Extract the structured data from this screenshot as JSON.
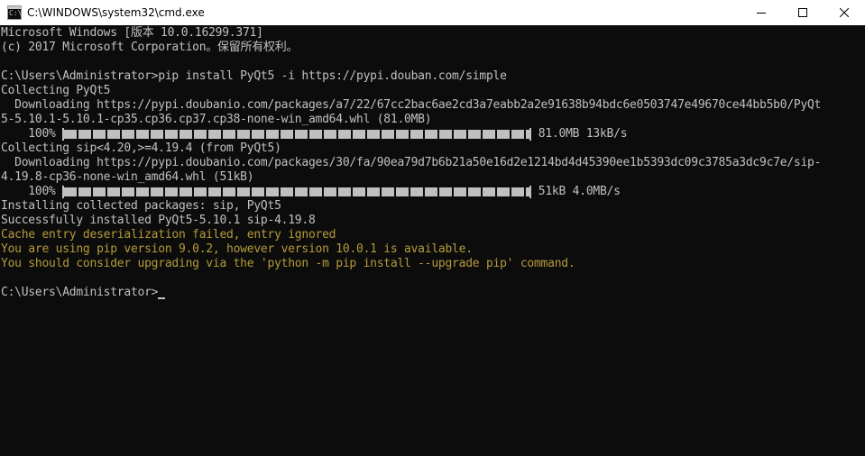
{
  "window": {
    "title": "C:\\WINDOWS\\system32\\cmd.exe",
    "icon": "cmd-icon",
    "controls": [
      "minimize-icon",
      "maximize-icon",
      "close-icon"
    ]
  },
  "console": {
    "text_color": "#c0c0c0",
    "warning_color": "#b59a3a",
    "background": "#0c0c0c",
    "lines": {
      "l1": "Microsoft Windows [版本 10.0.16299.371]",
      "l2": "(c) 2017 Microsoft Corporation。保留所有权利。",
      "l3": "",
      "l4": "C:\\Users\\Administrator>pip install PyQt5 -i https://pypi.douban.com/simple",
      "l5": "Collecting PyQt5",
      "l6": "  Downloading https://pypi.doubanio.com/packages/a7/22/67cc2bac6ae2cd3a7eabb2a2e91638b94bdc6e0503747e49670ce44bb5b0/PyQt",
      "l7": "5-5.10.1-5.10.1-cp35.cp36.cp37.cp38-none-win_amd64.whl (81.0MB)",
      "l9": "Collecting sip<4.20,>=4.19.4 (from PyQt5)",
      "l10": "  Downloading https://pypi.doubanio.com/packages/30/fa/90ea79d7b6b21a50e16d2e1214bd4d45390ee1b5393dc09c3785a3dc9c7e/sip-",
      "l11": "4.19.8-cp36-none-win_amd64.whl (51kB)",
      "l13": "Installing collected packages: sip, PyQt5",
      "l14": "Successfully installed PyQt5-5.10.1 sip-4.19.8",
      "l15": "Cache entry deserialization failed, entry ignored",
      "l16": "You are using pip version 9.0.2, however version 10.0.1 is available.",
      "l17": "You should consider upgrading via the 'python -m pip install --upgrade pip' command.",
      "l18": "",
      "l19": "C:\\Users\\Administrator>"
    },
    "progress": [
      {
        "percent_label": "    100% ",
        "fraction": 1.0,
        "stats": " 81.0MB 13kB/s"
      },
      {
        "percent_label": "    100% ",
        "fraction": 1.0,
        "stats": " 51kB 4.0MB/s"
      }
    ]
  }
}
